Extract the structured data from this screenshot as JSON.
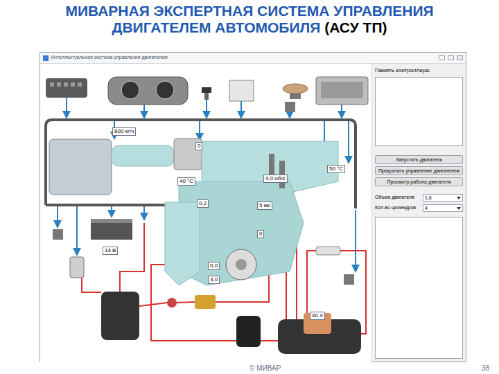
{
  "slide": {
    "title_line1": "МИВАРНАЯ ЭКСПЕРТНАЯ СИСТЕМА  УПРАВЛЕНИЯ",
    "title_line2": "ДВИГАТЕЛЕМ АВТОМОБИЛЯ",
    "title_suffix": "(АСУ ТП)",
    "footer": "© МИВАР",
    "page": "38"
  },
  "window": {
    "title": "Интеллектуальная система управления двигателем"
  },
  "diagram": {
    "readouts": [
      {
        "value": "600 кг/ч"
      },
      {
        "value": "0"
      },
      {
        "value": "40 °C"
      },
      {
        "value": "4,0 об/с"
      },
      {
        "value": "50 °C"
      },
      {
        "value": "0,2"
      },
      {
        "value": "5 мс"
      },
      {
        "value": "0"
      },
      {
        "value": "14 В"
      },
      {
        "value": "0,0"
      },
      {
        "value": "3,0"
      },
      {
        "value": "40 л"
      }
    ]
  },
  "panel": {
    "memory_label": "Память контроллера:",
    "buttons": [
      "Запустить двигатель",
      "Прекратить управление двигателем",
      "Просмотр работы двигателя"
    ],
    "fields": [
      {
        "label": "Объем двигателя",
        "value": "1,6"
      },
      {
        "label": "Кол-во цилиндров",
        "value": "4"
      }
    ]
  }
}
